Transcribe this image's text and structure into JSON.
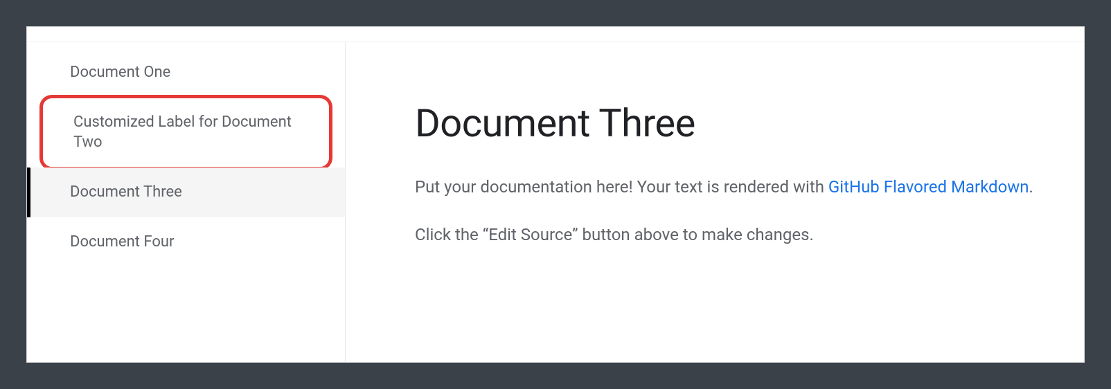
{
  "sidebar": {
    "items": [
      {
        "label": "Document One"
      },
      {
        "label": "Customized Label for Document Two"
      },
      {
        "label": "Document Three"
      },
      {
        "label": "Document Four"
      }
    ]
  },
  "main": {
    "title": "Document Three",
    "para1_pre": "Put your documentation here! Your text is rendered with ",
    "para1_link": "GitHub Flavored Markdown",
    "para1_post": ".",
    "para2": "Click the “Edit Source” button above to make changes."
  }
}
